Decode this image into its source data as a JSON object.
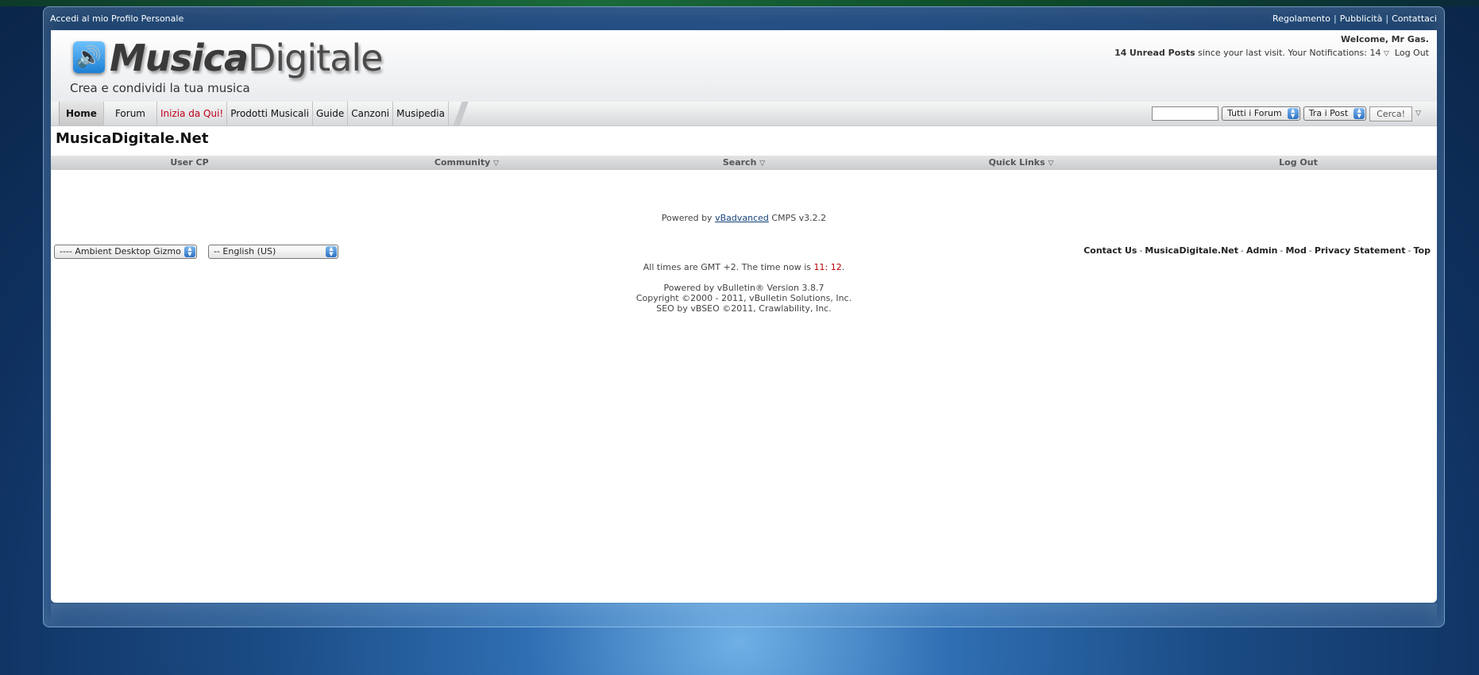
{
  "topbar": {
    "left_link": "Accedi al mio Profilo Personale",
    "right_links": [
      "Regolamento",
      "Pubblicità",
      "Contattaci"
    ]
  },
  "logo": {
    "name_part1": "Musica",
    "name_part2": "Digitale",
    "tagline": "Crea e condividi la tua musica"
  },
  "user": {
    "welcome": "Welcome,",
    "username": "Mr Gas.",
    "unread_count": "14",
    "unread_label": "Unread Posts",
    "since_text": "since your last visit.",
    "notifications_label": "Your Notifications:",
    "notifications_count": "14",
    "logout": "Log Out"
  },
  "nav": {
    "tabs": [
      "Home",
      "Forum",
      "Inizia da Qui!",
      "Prodotti Musicali",
      "Guide",
      "Canzoni",
      "Musipedia"
    ]
  },
  "search": {
    "scope": "Tutti i Forum",
    "type": "Tra i Post",
    "button": "Cerca!"
  },
  "site_title": "MusicaDigitale.Net",
  "subnav": [
    "User CP",
    "Community",
    "Search",
    "Quick Links",
    "Log Out"
  ],
  "powered_cmps": {
    "prefix": "Powered by",
    "link": "vBadvanced",
    "suffix": "CMPS v3.2.2"
  },
  "footer": {
    "style_select": "---- Ambient Desktop Gizmo",
    "language_select": "-- English (US)",
    "links": [
      "Contact Us",
      "MusicaDigitale.Net",
      "Admin",
      "Mod",
      "Privacy Statement",
      "Top"
    ],
    "time_prefix": "All times are GMT +2. The time now is",
    "time_hour": "11",
    "time_minute": "12",
    "copyright_lines": [
      "Powered by vBulletin® Version 3.8.7",
      "Copyright ©2000 - 2011, vBulletin Solutions, Inc.",
      "SEO by vBSEO ©2011, Crawlability, Inc."
    ]
  }
}
